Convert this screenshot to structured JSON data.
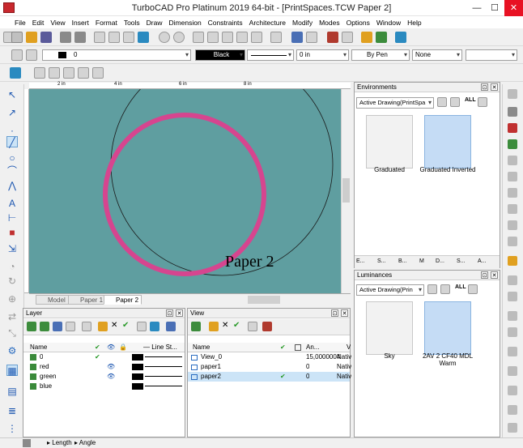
{
  "window": {
    "title": "TurboCAD Pro Platinum 2019 64-bit - [PrintSpaces.TCW Paper 2]",
    "minimize": "—",
    "maximize": "☐",
    "close": "✕"
  },
  "menu": [
    "File",
    "Edit",
    "View",
    "Insert",
    "Format",
    "Tools",
    "Draw",
    "Dimension",
    "Constraints",
    "Architecture",
    "Modify",
    "Modes",
    "Options",
    "Window",
    "Help"
  ],
  "props_bar": {
    "layer_value": "0",
    "color_label": "Black",
    "line_width": "0 in",
    "line_style": "By Pen",
    "fill": "None"
  },
  "canvas": {
    "background": "#5f9ea0",
    "circle_color": "#d6458f",
    "label": "Paper 2",
    "ruler_marks": [
      "2 in",
      "4 in",
      "6 in",
      "8 in",
      "1 in"
    ]
  },
  "sheet_tabs": [
    "Model",
    "Paper 1",
    "Paper 2"
  ],
  "layer_panel": {
    "title": "Layer",
    "columns": [
      "Name",
      "✔",
      "👁",
      "🔒",
      "",
      "— Line St..."
    ],
    "rows": [
      {
        "name": "0",
        "current": "✔",
        "visible": "",
        "color": "#000000"
      },
      {
        "name": "red",
        "current": "",
        "visible": "👁",
        "color": "#000000"
      },
      {
        "name": "green",
        "current": "",
        "visible": "👁",
        "color": "#000000"
      },
      {
        "name": "blue",
        "current": "",
        "visible": "",
        "color": "#000000"
      }
    ]
  },
  "view_panel": {
    "title": "View",
    "columns": [
      "Name",
      "✔",
      "",
      "An...",
      "V"
    ],
    "rows": [
      {
        "name": "View_0",
        "check": "",
        "angle": "15,0000004",
        "v": "Nativ"
      },
      {
        "name": "paper1",
        "check": "",
        "angle": "0",
        "v": "Nativ"
      },
      {
        "name": "paper2",
        "check": "✔",
        "angle": "0",
        "v": "Nativ"
      }
    ]
  },
  "environments_panel": {
    "title": "Environments",
    "dropdown": "Active Drawing(PrintSpa",
    "buttons": [
      "ALL"
    ],
    "items": [
      {
        "label": "Graduated",
        "color": "#f2f2f2"
      },
      {
        "label": "Graduated Inverted",
        "color": "#c5dcf5"
      }
    ],
    "tabs": [
      "E...",
      "S...",
      "B...",
      "M",
      "D...",
      "S...",
      "A..."
    ]
  },
  "luminances_panel": {
    "title": "Luminances",
    "dropdown": "Active Drawing(Prin",
    "buttons": [
      "ALL"
    ],
    "items": [
      {
        "label": "Sky",
        "color": "#f2f2f2"
      },
      {
        "label": "2AV 2 CF40 MDL Warm",
        "color": "#c5dcf5"
      }
    ]
  },
  "status": {
    "length": "Length",
    "angle": "Angle"
  }
}
